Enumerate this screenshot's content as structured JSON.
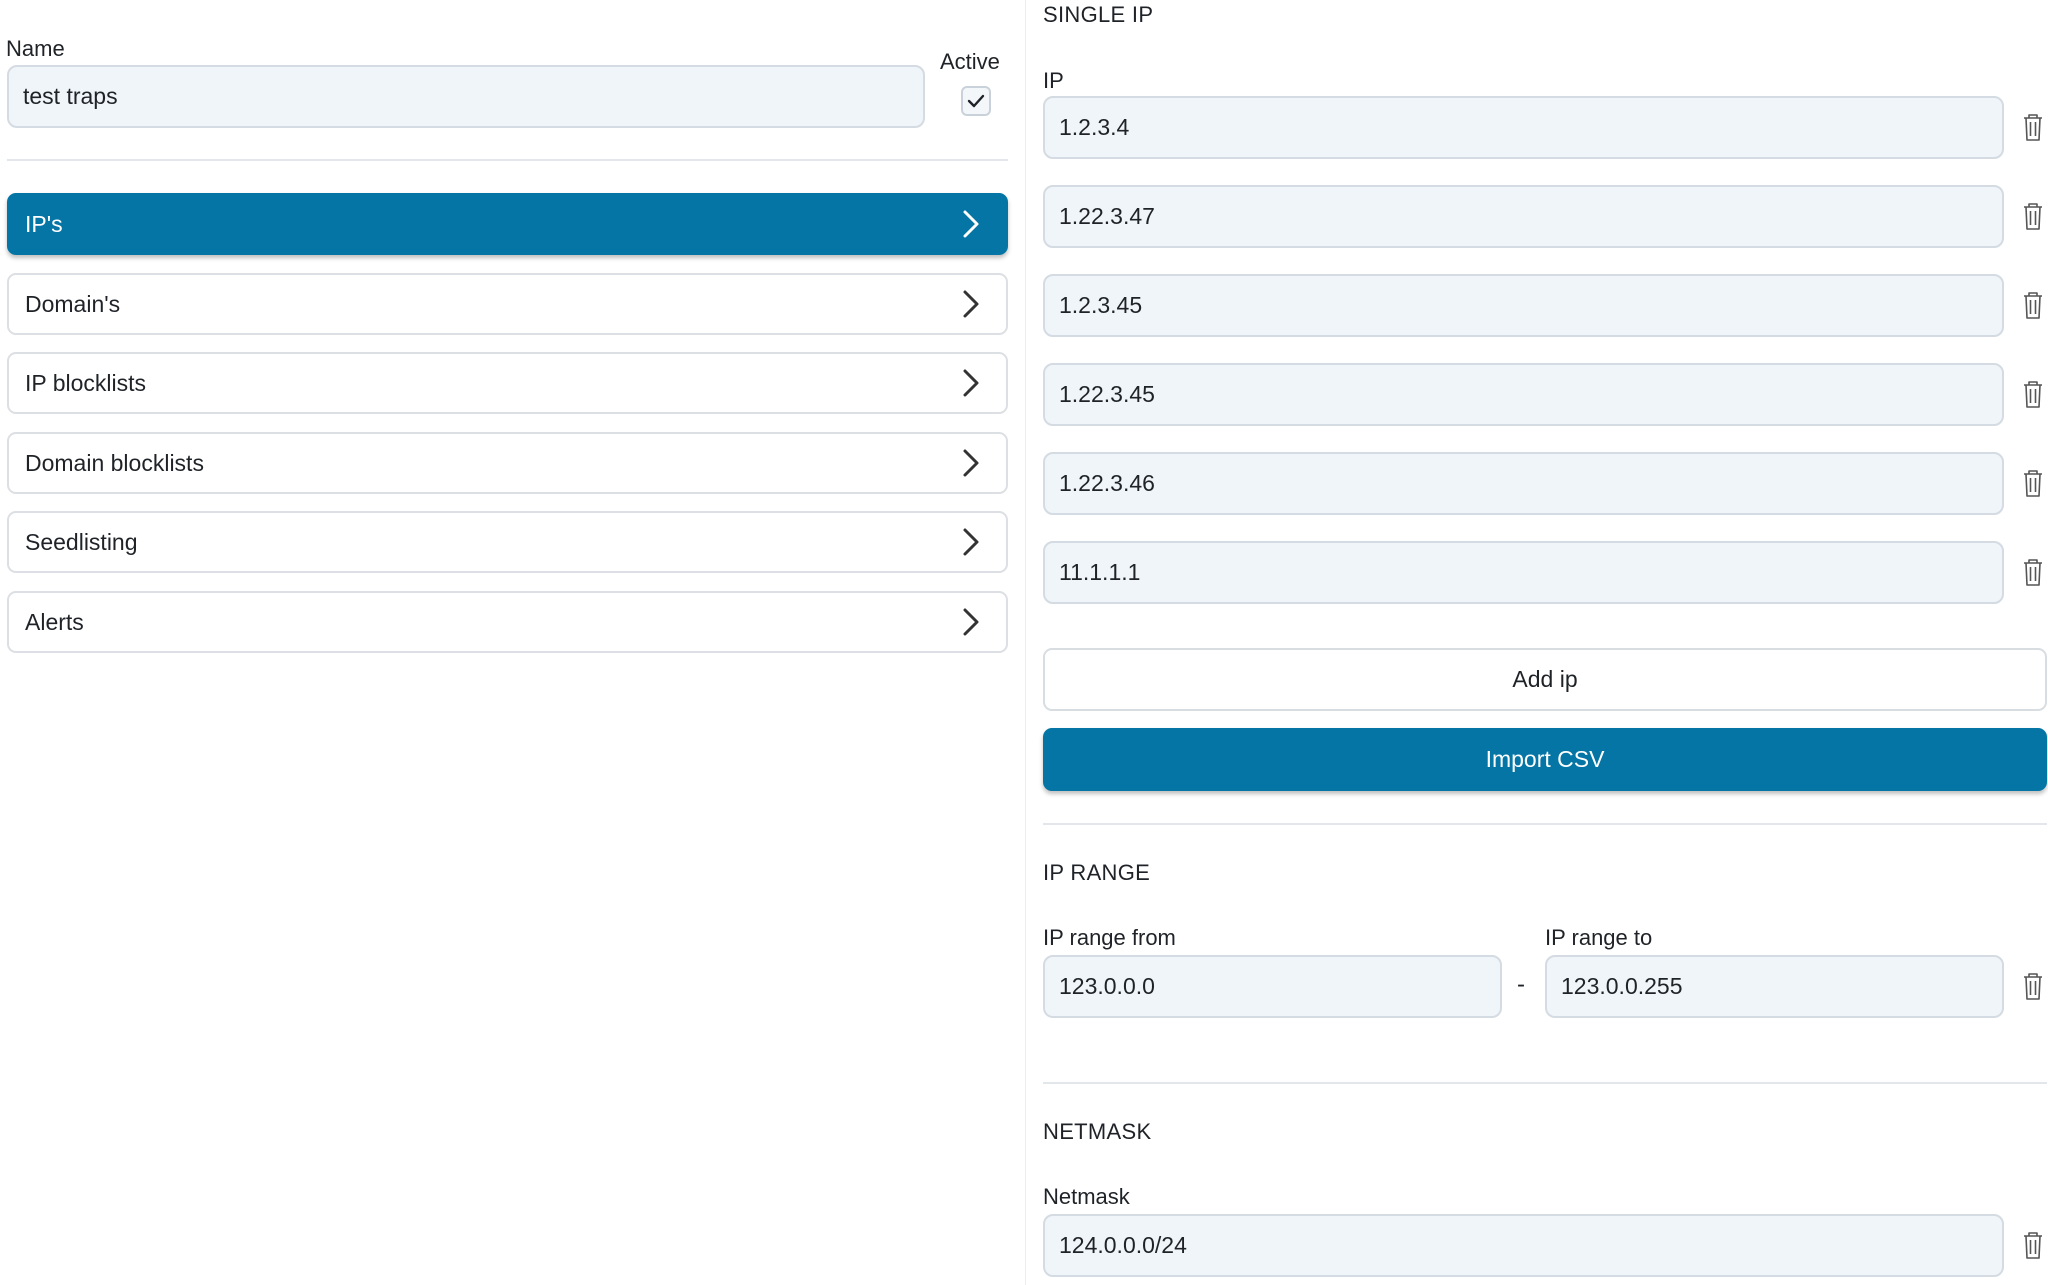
{
  "general": {
    "name_label": "Name",
    "name_value": "test traps",
    "active_label": "Active",
    "active_checked": true
  },
  "nav": {
    "items": [
      {
        "label": "IP's",
        "active": true
      },
      {
        "label": "Domain's",
        "active": false
      },
      {
        "label": "IP blocklists",
        "active": false
      },
      {
        "label": "Domain blocklists",
        "active": false
      },
      {
        "label": "Seedlisting",
        "active": false
      },
      {
        "label": "Alerts",
        "active": false
      }
    ]
  },
  "single_ip": {
    "title": "SINGLE IP",
    "field_label": "IP",
    "values": [
      "1.2.3.4",
      "1.22.3.47",
      "1.2.3.45",
      "1.22.3.45",
      "1.22.3.46",
      "11.1.1.1"
    ],
    "add_button": "Add ip",
    "import_button": "Import CSV"
  },
  "ip_range": {
    "title": "IP RANGE",
    "from_label": "IP range from",
    "to_label": "IP range to",
    "from_value": "123.0.0.0",
    "to_value": "123.0.0.255",
    "separator": "-"
  },
  "netmask": {
    "title": "NETMASK",
    "field_label": "Netmask",
    "value": "124.0.0.0/24"
  },
  "colors": {
    "accent": "#0475a5",
    "field_bg": "#f0f5f9",
    "field_border": "#d4dbe2"
  },
  "icons": [
    "checkmark-icon",
    "chevron-right-icon",
    "trash-icon"
  ]
}
